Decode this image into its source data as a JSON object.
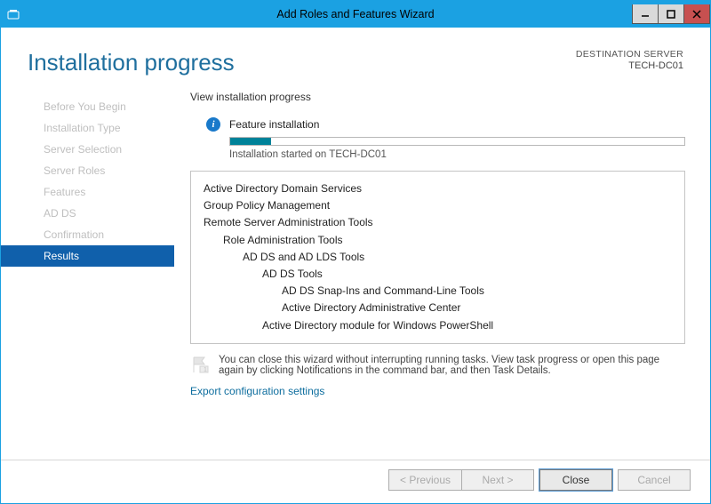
{
  "window": {
    "title": "Add Roles and Features Wizard"
  },
  "header": {
    "page_title": "Installation progress",
    "destination_label": "DESTINATION SERVER",
    "destination_server": "TECH-DC01"
  },
  "sidebar": {
    "steps": [
      {
        "label": "Before You Begin",
        "active": false
      },
      {
        "label": "Installation Type",
        "active": false
      },
      {
        "label": "Server Selection",
        "active": false
      },
      {
        "label": "Server Roles",
        "active": false
      },
      {
        "label": "Features",
        "active": false
      },
      {
        "label": "AD DS",
        "active": false
      },
      {
        "label": "Confirmation",
        "active": false
      },
      {
        "label": "Results",
        "active": true
      }
    ]
  },
  "main": {
    "instruction": "View installation progress",
    "status": "Feature installation",
    "progress_percent": 9,
    "progress_label": "Installation started on TECH-DC01",
    "items": [
      {
        "label": "Active Directory Domain Services",
        "indent": 0
      },
      {
        "label": "Group Policy Management",
        "indent": 0
      },
      {
        "label": "Remote Server Administration Tools",
        "indent": 0
      },
      {
        "label": "Role Administration Tools",
        "indent": 1
      },
      {
        "label": "AD DS and AD LDS Tools",
        "indent": 2
      },
      {
        "label": "AD DS Tools",
        "indent": 3
      },
      {
        "label": "AD DS Snap-Ins and Command-Line Tools",
        "indent": 4
      },
      {
        "label": "Active Directory Administrative Center",
        "indent": 4
      },
      {
        "label": "Active Directory module for Windows PowerShell",
        "indent": 3
      }
    ],
    "tip": "You can close this wizard without interrupting running tasks. View task progress or open this page again by clicking Notifications in the command bar, and then Task Details.",
    "export_link": "Export configuration settings"
  },
  "buttons": {
    "previous": "< Previous",
    "next": "Next >",
    "close": "Close",
    "cancel": "Cancel"
  }
}
